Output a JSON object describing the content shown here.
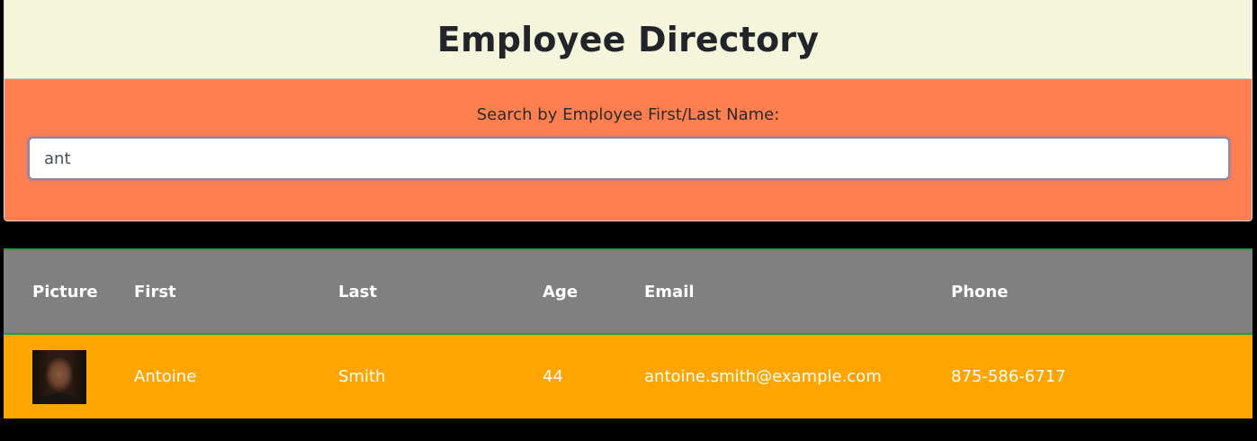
{
  "header": {
    "title": "Employee Directory"
  },
  "search": {
    "label": "Search by Employee First/Last Name:",
    "value": "ant",
    "placeholder": ""
  },
  "table": {
    "columns": [
      "Picture",
      "First",
      "Last",
      "Age",
      "Email",
      "Phone"
    ],
    "rows": [
      {
        "picture": "employee-photo",
        "first": "Antoine",
        "last": "Smith",
        "age": "44",
        "email": "antoine.smith@example.com",
        "phone": "875-586-6717"
      }
    ]
  },
  "colors": {
    "header_background": "#f5f5dc",
    "search_background": "#ff7f50",
    "table_header_background": "#808080",
    "row_background": "#ffa500",
    "page_background": "#000000"
  }
}
